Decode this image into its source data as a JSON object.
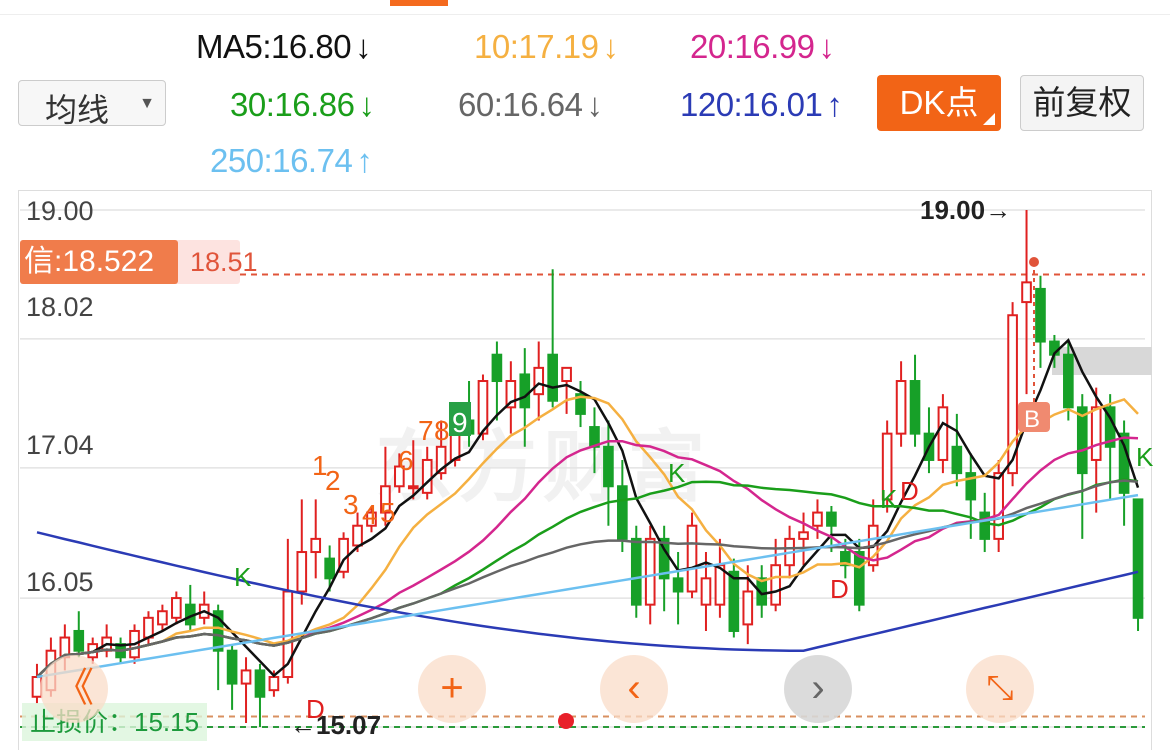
{
  "ma_legend": {
    "ma5": {
      "text": "MA5:16.80",
      "arrow": "↓",
      "color": "#111111"
    },
    "ma10": {
      "text": "10:17.19",
      "arrow": "↓",
      "color": "#f5b041"
    },
    "ma20": {
      "text": "20:16.99",
      "arrow": "↓",
      "color": "#d4268e"
    },
    "ma30": {
      "text": "30:16.86",
      "arrow": "↓",
      "color": "#1a9e1a"
    },
    "ma60": {
      "text": "60:16.64",
      "arrow": "↓",
      "color": "#666666"
    },
    "ma120": {
      "text": "120:16.01",
      "arrow": "↑",
      "color": "#2b3bb5"
    },
    "ma250": {
      "text": "250:16.74",
      "arrow": "↑",
      "color": "#6cc0f0"
    }
  },
  "toolbar": {
    "indicator_select": "均线",
    "indicator_caret": "▼",
    "dk_button": "DK点",
    "adjust_button": "前复权"
  },
  "chart": {
    "y_labels": [
      "19.00",
      "18.02",
      "17.04",
      "16.05",
      "15.07"
    ],
    "signal_tag": "信:18.522",
    "signal_value": "18.51",
    "high_label": "19.00→",
    "low_label": "←15.07",
    "stop_label": "止损价：15.15",
    "watermark": "东方财富",
    "count_labels": [
      "1",
      "2",
      "3",
      "4",
      "5",
      "6",
      "7",
      "8",
      "9"
    ],
    "markers": [
      "K",
      "D",
      "D",
      "D",
      "K",
      "B",
      "K",
      "K"
    ]
  },
  "controls": {
    "prev": "《",
    "zoom_in": "+",
    "back": "‹",
    "forward": "›",
    "fullscreen": "⤡"
  },
  "chart_data": {
    "type": "candlestick",
    "ylim": [
      15.0,
      19.2
    ],
    "y_ticks": [
      19.0,
      18.02,
      17.04,
      16.05,
      15.07
    ],
    "signal_price": 18.51,
    "stop_price": 15.15,
    "period_high": 19.0,
    "period_low": 15.07,
    "candles": [
      [
        15.3,
        15.45,
        15.55,
        15.25
      ],
      [
        15.35,
        15.65,
        15.75,
        15.3
      ],
      [
        15.6,
        15.75,
        15.85,
        15.5
      ],
      [
        15.8,
        15.65,
        15.95,
        15.6
      ],
      [
        15.6,
        15.7,
        15.75,
        15.55
      ],
      [
        15.65,
        15.75,
        15.85,
        15.6
      ],
      [
        15.7,
        15.6,
        15.75,
        15.55
      ],
      [
        15.6,
        15.8,
        15.85,
        15.55
      ],
      [
        15.75,
        15.9,
        15.95,
        15.7
      ],
      [
        15.85,
        15.95,
        16.0,
        15.8
      ],
      [
        15.9,
        16.05,
        16.1,
        15.85
      ],
      [
        16.0,
        15.85,
        16.15,
        15.8
      ],
      [
        15.9,
        16.0,
        16.1,
        15.85
      ],
      [
        15.95,
        15.65,
        16.0,
        15.35
      ],
      [
        15.65,
        15.4,
        15.7,
        15.2
      ],
      [
        15.4,
        15.5,
        15.6,
        15.1
      ],
      [
        15.5,
        15.3,
        15.55,
        15.07
      ],
      [
        15.35,
        15.45,
        15.5,
        15.3
      ],
      [
        15.45,
        16.1,
        16.5,
        15.4
      ],
      [
        16.1,
        16.4,
        16.8,
        16.0
      ],
      [
        16.4,
        16.5,
        16.8,
        16.2
      ],
      [
        16.35,
        16.2,
        16.45,
        16.1
      ],
      [
        16.25,
        16.5,
        16.55,
        16.2
      ],
      [
        16.45,
        16.6,
        16.7,
        16.4
      ],
      [
        16.6,
        16.7,
        16.75,
        16.55
      ],
      [
        16.7,
        16.9,
        17.2,
        16.6
      ],
      [
        16.9,
        17.05,
        17.15,
        16.85
      ],
      [
        16.9,
        16.9,
        17.25,
        16.8
      ],
      [
        16.85,
        17.1,
        17.2,
        16.8
      ],
      [
        17.0,
        17.2,
        17.4,
        16.95
      ],
      [
        17.1,
        17.3,
        17.5,
        17.05
      ],
      [
        17.4,
        17.3,
        17.7,
        17.2
      ],
      [
        17.3,
        17.7,
        17.75,
        17.25
      ],
      [
        17.9,
        17.7,
        18.0,
        17.4
      ],
      [
        17.5,
        17.7,
        17.85,
        17.3
      ],
      [
        17.75,
        17.5,
        17.95,
        17.2
      ],
      [
        17.6,
        17.8,
        18.0,
        17.4
      ],
      [
        17.9,
        17.55,
        18.55,
        17.5
      ],
      [
        17.7,
        17.8,
        17.8,
        17.45
      ],
      [
        17.6,
        17.45,
        17.7,
        17.35
      ],
      [
        17.35,
        17.2,
        17.5,
        17.0
      ],
      [
        17.2,
        16.9,
        17.4,
        16.6
      ],
      [
        16.9,
        16.5,
        17.1,
        16.4
      ],
      [
        16.5,
        16.0,
        16.6,
        15.9
      ],
      [
        16.0,
        16.5,
        16.6,
        15.85
      ],
      [
        16.5,
        16.2,
        16.6,
        15.95
      ],
      [
        16.2,
        16.1,
        16.4,
        15.85
      ],
      [
        16.1,
        16.6,
        16.7,
        16.05
      ],
      [
        16.0,
        16.2,
        16.4,
        15.8
      ],
      [
        16.0,
        16.3,
        16.5,
        15.9
      ],
      [
        16.25,
        15.8,
        16.35,
        15.75
      ],
      [
        15.85,
        16.1,
        16.3,
        15.7
      ],
      [
        16.2,
        16.0,
        16.3,
        15.9
      ],
      [
        16.0,
        16.3,
        16.5,
        15.95
      ],
      [
        16.3,
        16.5,
        16.6,
        16.2
      ],
      [
        16.5,
        16.55,
        16.7,
        16.3
      ],
      [
        16.6,
        16.7,
        16.8,
        16.5
      ],
      [
        16.7,
        16.6,
        16.75,
        16.4
      ],
      [
        16.4,
        16.3,
        16.5,
        16.2
      ],
      [
        16.4,
        16.0,
        16.5,
        15.95
      ],
      [
        16.3,
        16.6,
        16.8,
        16.25
      ],
      [
        16.8,
        17.3,
        17.4,
        16.7
      ],
      [
        17.3,
        17.7,
        17.85,
        17.2
      ],
      [
        17.7,
        17.3,
        17.9,
        17.2
      ],
      [
        17.3,
        17.1,
        17.5,
        17.0
      ],
      [
        17.1,
        17.5,
        17.6,
        17.0
      ],
      [
        17.2,
        17.0,
        17.45,
        16.9
      ],
      [
        17.0,
        16.8,
        17.15,
        16.5
      ],
      [
        16.7,
        16.5,
        16.85,
        16.4
      ],
      [
        16.5,
        17.0,
        17.1,
        16.4
      ],
      [
        17.0,
        18.2,
        18.3,
        16.9
      ],
      [
        18.3,
        18.45,
        19.0,
        17.6
      ],
      [
        18.4,
        18.0,
        18.5,
        17.8
      ],
      [
        18.0,
        17.9,
        18.05,
        17.8
      ],
      [
        17.9,
        17.5,
        18.0,
        17.4
      ],
      [
        17.5,
        17.0,
        17.6,
        16.5
      ],
      [
        17.1,
        17.5,
        17.65,
        16.7
      ],
      [
        17.5,
        17.2,
        17.6,
        16.8
      ],
      [
        17.3,
        16.85,
        17.4,
        16.6
      ],
      [
        16.8,
        15.9,
        16.8,
        15.8
      ]
    ]
  }
}
